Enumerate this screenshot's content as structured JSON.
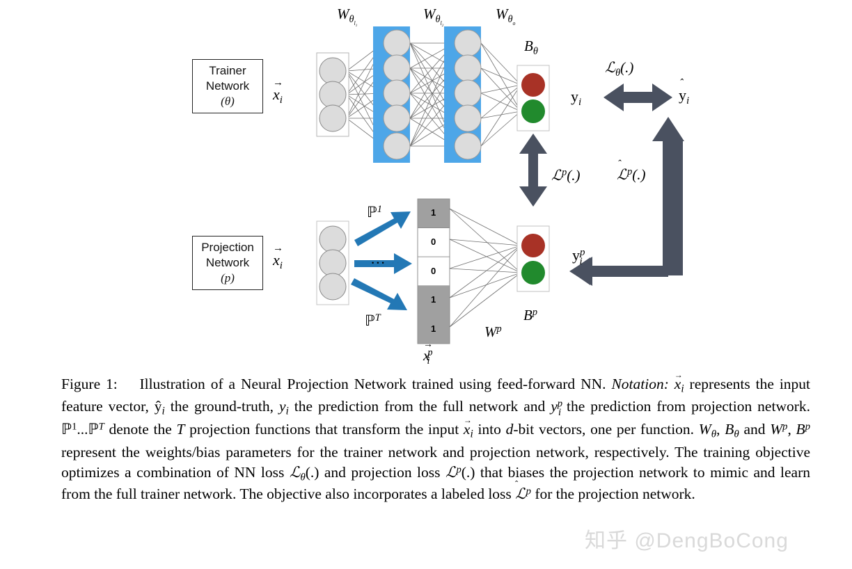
{
  "figure": {
    "trainer_box": {
      "line1": "Trainer",
      "line2": "Network",
      "line3": "(θ)"
    },
    "projection_box": {
      "line1": "Projection",
      "line2": "Network",
      "line3": "(p)"
    },
    "labels": {
      "trainer_input": "x⃗i",
      "projection_input": "x⃗i",
      "weight_layer1": "Wθl1",
      "weight_layer2": "Wθl2",
      "weight_out": "Wθo",
      "bias_theta": "Bθ",
      "bias_p": "Bp",
      "weight_p": "Wp",
      "projection_vector": "x⃗ip",
      "proj_fn_first": "P1",
      "proj_fn_dots": "...",
      "proj_fn_last": "PT",
      "y_i": "yi",
      "y_hat_i": "ŷi",
      "y_i_p": "yip",
      "loss_theta": "Lθ(.)",
      "loss_p": "Lp(.)",
      "loss_p_hat": "L̂p(.)"
    },
    "projection_vector_cells": [
      {
        "value": "1",
        "filled": true
      },
      {
        "value": "0",
        "filled": false
      },
      {
        "value": "0",
        "filled": false
      },
      {
        "value": "1",
        "filled": true
      },
      {
        "value": "1",
        "filled": true
      }
    ],
    "colors": {
      "hidden_layer_blue": "#4da6e8",
      "arrow_blue": "#2378b5",
      "arrow_dark": "#4a5160",
      "node_gray": "#d9d9d9",
      "cell_gray": "#a0a0a0",
      "output_red": "#a83226",
      "output_green": "#218a2d",
      "edge_gray": "#6e6e6e"
    },
    "layer_node_counts": {
      "input": 3,
      "hidden1": 5,
      "hidden2": 5,
      "output": 2,
      "projection_input": 3,
      "projection_output": 2
    }
  },
  "caption": {
    "label": "Figure 1:",
    "title_sentence": "Illustration of a Neural Projection Network trained using feed-forward NN.",
    "notation_word": "Notation:",
    "body": "x⃗i represents the input feature vector, ŷi the ground-truth, yi the prediction from the full network and yip the prediction from projection network. P1...PT denote the T projection functions that transform the input x⃗i into d-bit vectors, one per function. Wθ, Bθ and Wp, Bp represent the weights/bias parameters for the trainer network and projection network, respectively. The training objective optimizes a combination of NN loss Lθ(.) and projection loss Lp(.) that biases the projection network to mimic and learn from the full trainer network. The objective also incorporates a labeled loss L̂p for the projection network."
  },
  "watermark": {
    "text": "知乎 @DengBoCong"
  }
}
